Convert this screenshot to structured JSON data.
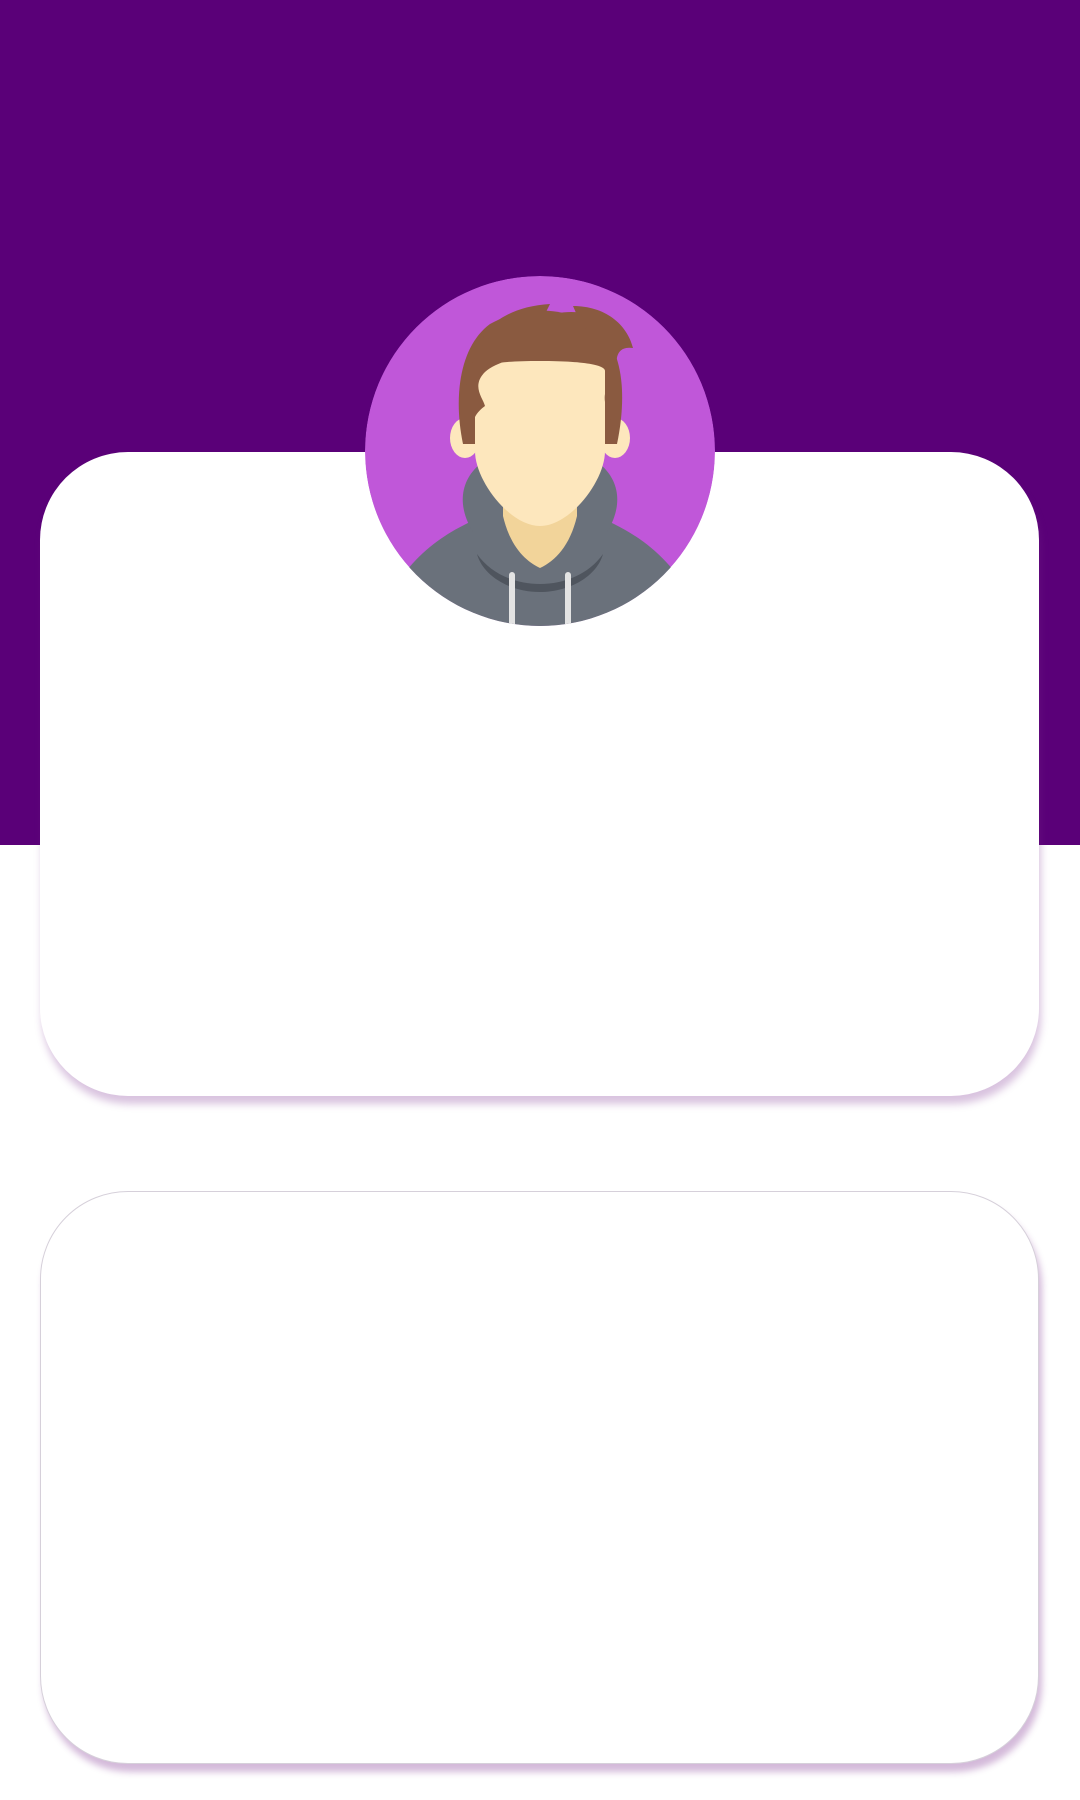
{
  "colors": {
    "header_background": "#5a0078",
    "avatar_background": "#c057d9",
    "card_background": "#ffffff",
    "hair": "#8a5a40",
    "skin": "#fde7bd",
    "hoodie": "#6a717b"
  },
  "profile": {
    "avatar_icon": "user-avatar-icon"
  }
}
